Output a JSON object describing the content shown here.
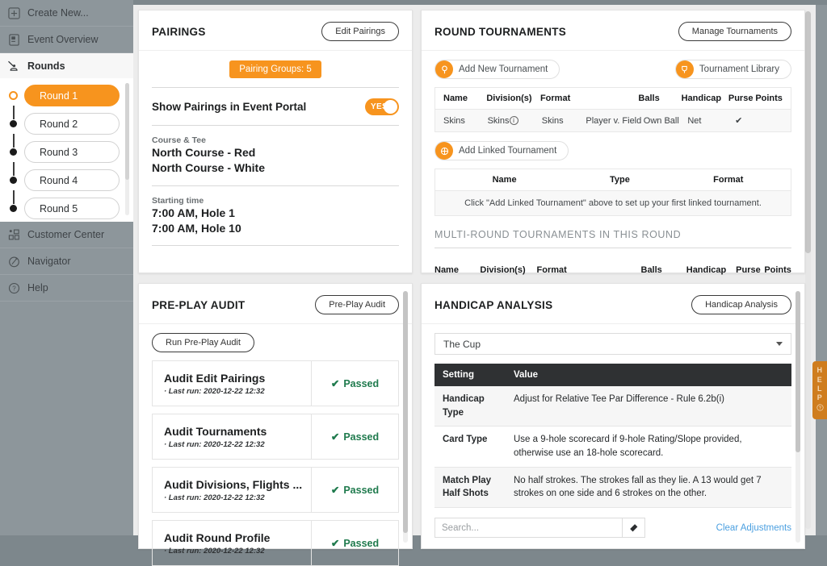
{
  "sidebar": {
    "top_items": [
      {
        "label": "Create New...",
        "icon": "plus-square-icon"
      },
      {
        "label": "Event Overview",
        "icon": "event-overview-icon"
      }
    ],
    "section": {
      "label": "Rounds",
      "icon": "rounds-flag-icon"
    },
    "rounds": [
      {
        "label": "Round 1",
        "selected": true
      },
      {
        "label": "Round 2",
        "selected": false
      },
      {
        "label": "Round 3",
        "selected": false
      },
      {
        "label": "Round 4",
        "selected": false
      },
      {
        "label": "Round 5",
        "selected": false
      }
    ],
    "bottom_items": [
      {
        "label": "Customer Center",
        "icon": "customer-center-icon"
      },
      {
        "label": "Navigator",
        "icon": "navigator-compass-icon"
      },
      {
        "label": "Help",
        "icon": "help-question-icon"
      }
    ]
  },
  "pairings": {
    "title": "PAIRINGS",
    "edit_button": "Edit Pairings",
    "groups_badge": "Pairing Groups: 5",
    "portal_label": "Show Pairings in Event Portal",
    "portal_toggle": "YES",
    "course_tee_label": "Course & Tee",
    "courses": [
      "North Course - Red",
      "North Course - White"
    ],
    "starting_time_label": "Starting time",
    "starting_times": [
      "7:00 AM, Hole 1",
      "7:00 AM, Hole 10"
    ]
  },
  "round_tournaments": {
    "title": "ROUND TOURNAMENTS",
    "manage_button": "Manage Tournaments",
    "add_new_button": "Add New Tournament",
    "library_button": "Tournament Library",
    "add_linked_button": "Add Linked Tournament",
    "columns": [
      "Name",
      "Division(s)",
      "Format",
      "",
      "Balls",
      "Handicap",
      "Purse",
      "Points"
    ],
    "rows": [
      {
        "name": "Skins",
        "divisions": "Skins",
        "divisions_info": "i",
        "format": "Skins",
        "format2": "Player v. Field",
        "balls": "Own Ball",
        "handicap": "Net",
        "purse": "✔",
        "points": ""
      }
    ],
    "linked_columns": [
      "Name",
      "Type",
      "Format"
    ],
    "linked_empty": "Click \"Add Linked Tournament\" above to set up your first linked tournament.",
    "multi_round_title": "MULTI-ROUND TOURNAMENTS IN THIS ROUND",
    "multi_round_columns": [
      "Name",
      "Division(s)",
      "Format",
      "Balls",
      "Handicap",
      "Purse",
      "Points"
    ]
  },
  "pre_play_audit": {
    "title": "PRE-PLAY AUDIT",
    "header_button": "Pre-Play Audit",
    "run_button": "Run Pre-Play Audit",
    "items": [
      {
        "name": "Audit Edit Pairings",
        "last_run": "· Last run: 2020-12-22 12:32",
        "status": "Passed"
      },
      {
        "name": "Audit Tournaments",
        "last_run": "· Last run: 2020-12-22 12:32",
        "status": "Passed"
      },
      {
        "name": "Audit Divisions, Flights ...",
        "last_run": "· Last run: 2020-12-22 12:32",
        "status": "Passed"
      },
      {
        "name": "Audit Round Profile",
        "last_run": "· Last run: 2020-12-22 12:32",
        "status": "Passed"
      }
    ]
  },
  "handicap_analysis": {
    "title": "HANDICAP ANALYSIS",
    "header_button": "Handicap Analysis",
    "select_value": "The Cup",
    "columns": [
      "Setting",
      "Value"
    ],
    "rows": [
      {
        "setting": "Handicap Type",
        "value": "Adjust for Relative Tee Par Difference - Rule 6.2b(i)"
      },
      {
        "setting": "Card Type",
        "value": "Use a 9-hole scorecard if 9-hole Rating/Slope provided, otherwise use an 18-hole scorecard."
      },
      {
        "setting": "Match Play Half Shots",
        "value": "No half strokes. The strokes fall as they lie. A 13 would get 7 strokes on one side and 6 strokes on the other."
      }
    ],
    "search_placeholder": "Search...",
    "search_value": "",
    "eraser_icon": "eraser-icon",
    "clear_link": "Clear Adjustments"
  },
  "help_tab": {
    "letters": [
      "H",
      "E",
      "L",
      "P"
    ],
    "icon": "question-circle-icon"
  },
  "colors": {
    "accent_orange": "#F7941E",
    "sidebar_gray": "#8d969b",
    "canvas_gray": "#ececec",
    "link_blue": "#5bb4e8",
    "pass_green": "#1f7a4d",
    "table_header_dark": "#2f3133"
  }
}
